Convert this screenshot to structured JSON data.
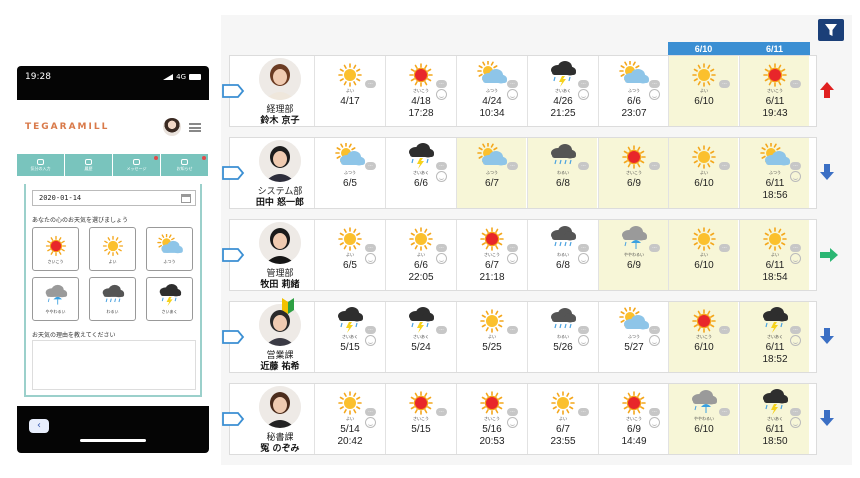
{
  "phone": {
    "time": "19:28",
    "network": "4G",
    "logo": "TEGARAMILL",
    "tabs": [
      {
        "label": "気分の入力"
      },
      {
        "label": "履歴"
      },
      {
        "label": "メッセージ"
      },
      {
        "label": "お知らせ"
      }
    ],
    "date_value": "2020-01-14",
    "prompt": "あなたの心のお天気を選びましょう",
    "options": [
      {
        "icon": "sunny-red",
        "label": "さいこう"
      },
      {
        "icon": "sunny",
        "label": "よい"
      },
      {
        "icon": "partly-cloudy",
        "label": "ふつう"
      },
      {
        "icon": "rain-cloud-umbrella",
        "label": "ややわるい"
      },
      {
        "icon": "rain-cloud",
        "label": "わるい"
      },
      {
        "icon": "thunder-cloud",
        "label": "さいあく"
      }
    ],
    "reason_prompt": "お天気の理由を教えてください",
    "back_label": "‹"
  },
  "dashboard": {
    "highlight_dates": [
      "6/10",
      "6/11"
    ],
    "colors": {
      "highlight": "#f7f6d7",
      "header": "#3b8fd3",
      "up": "#e02020",
      "down": "#3b6fc4",
      "flat": "#2bb673",
      "filter": "#1b3f78"
    },
    "rows": [
      {
        "dept": "経理部",
        "name": "鈴木 京子",
        "avatar": "woman-brown-hair",
        "trend": "up",
        "cells": [
          {
            "icon": "sunny",
            "label": "よい",
            "date": "4/17",
            "time": "",
            "smile": false,
            "hl": false
          },
          {
            "icon": "sunny-red",
            "label": "さいこう",
            "date": "4/18",
            "time": "17:28",
            "smile": true,
            "hl": false
          },
          {
            "icon": "partly-cloudy",
            "label": "ふつう",
            "date": "4/24",
            "time": "10:34",
            "smile": true,
            "hl": false
          },
          {
            "icon": "thunder-cloud",
            "label": "さいあく",
            "date": "4/26",
            "time": "21:25",
            "smile": true,
            "hl": false
          },
          {
            "icon": "partly-cloudy",
            "label": "ふつう",
            "date": "6/6",
            "time": "23:07",
            "smile": true,
            "hl": false
          },
          {
            "icon": "sunny",
            "label": "よい",
            "date": "6/10",
            "time": "",
            "smile": false,
            "hl": true
          },
          {
            "icon": "sunny-red",
            "label": "さいこう",
            "date": "6/11",
            "time": "19:43",
            "smile": false,
            "hl": true
          }
        ]
      },
      {
        "dept": "システム部",
        "name": "田中 怒一郎",
        "avatar": "man-short-hair",
        "trend": "down",
        "cells": [
          {
            "icon": "partly-cloudy",
            "label": "ふつう",
            "date": "6/5",
            "time": "",
            "smile": false,
            "hl": false
          },
          {
            "icon": "thunder-cloud",
            "label": "さいあく",
            "date": "6/6",
            "time": "",
            "smile": true,
            "hl": false
          },
          {
            "icon": "partly-cloudy",
            "label": "ふつう",
            "date": "6/7",
            "time": "",
            "smile": false,
            "hl": true
          },
          {
            "icon": "rain-cloud",
            "label": "わるい",
            "date": "6/8",
            "time": "",
            "smile": false,
            "hl": true
          },
          {
            "icon": "sunny-red",
            "label": "さいこう",
            "date": "6/9",
            "time": "",
            "smile": false,
            "hl": true
          },
          {
            "icon": "sunny",
            "label": "よい",
            "date": "6/10",
            "time": "",
            "smile": false,
            "hl": true
          },
          {
            "icon": "partly-cloudy",
            "label": "ふつう",
            "date": "6/11",
            "time": "18:56",
            "smile": true,
            "hl": true
          }
        ]
      },
      {
        "dept": "管理部",
        "name": "牧田 莉緒",
        "avatar": "woman-dark-hair",
        "trend": "flat",
        "cells": [
          {
            "icon": "sunny",
            "label": "よい",
            "date": "6/5",
            "time": "",
            "smile": true,
            "hl": false
          },
          {
            "icon": "sunny",
            "label": "よい",
            "date": "6/6",
            "time": "22:05",
            "smile": true,
            "hl": false
          },
          {
            "icon": "sunny-red",
            "label": "さいこう",
            "date": "6/7",
            "time": "21:18",
            "smile": true,
            "hl": false
          },
          {
            "icon": "rain-cloud",
            "label": "わるい",
            "date": "6/8",
            "time": "",
            "smile": true,
            "hl": false
          },
          {
            "icon": "rain-cloud-umbrella",
            "label": "ややわるい",
            "date": "6/9",
            "time": "",
            "smile": false,
            "hl": true
          },
          {
            "icon": "sunny",
            "label": "よい",
            "date": "6/10",
            "time": "",
            "smile": false,
            "hl": true
          },
          {
            "icon": "sunny",
            "label": "よい",
            "date": "6/11",
            "time": "18:54",
            "smile": true,
            "hl": true
          }
        ]
      },
      {
        "dept": "営業課",
        "name": "近藤 祐希",
        "avatar": "man-beginner-mark",
        "trend": "down",
        "cells": [
          {
            "icon": "thunder-cloud",
            "label": "さいあく",
            "date": "5/15",
            "time": "",
            "smile": true,
            "hl": false
          },
          {
            "icon": "thunder-cloud",
            "label": "さいあく",
            "date": "5/24",
            "time": "",
            "smile": false,
            "hl": false
          },
          {
            "icon": "sunny",
            "label": "よい",
            "date": "5/25",
            "time": "",
            "smile": false,
            "hl": false
          },
          {
            "icon": "rain-cloud",
            "label": "わるい",
            "date": "5/26",
            "time": "",
            "smile": true,
            "hl": false
          },
          {
            "icon": "partly-cloudy",
            "label": "ふつう",
            "date": "5/27",
            "time": "",
            "smile": true,
            "hl": false
          },
          {
            "icon": "sunny-red",
            "label": "さいこう",
            "date": "6/10",
            "time": "",
            "smile": false,
            "hl": true
          },
          {
            "icon": "thunder-cloud",
            "label": "さいあく",
            "date": "6/11",
            "time": "18:52",
            "smile": true,
            "hl": true
          }
        ]
      },
      {
        "dept": "秘書課",
        "name": "冤 のぞみ",
        "avatar": "woman-long-hair",
        "trend": "down",
        "cells": [
          {
            "icon": "sunny",
            "label": "よい",
            "date": "5/14",
            "time": "20:42",
            "smile": true,
            "hl": false
          },
          {
            "icon": "sunny-red",
            "label": "さいこう",
            "date": "5/15",
            "time": "",
            "smile": false,
            "hl": false
          },
          {
            "icon": "sunny-red",
            "label": "さいこう",
            "date": "5/16",
            "time": "20:53",
            "smile": true,
            "hl": false
          },
          {
            "icon": "sunny",
            "label": "よい",
            "date": "6/7",
            "time": "23:55",
            "smile": false,
            "hl": false
          },
          {
            "icon": "sunny-red",
            "label": "さいこう",
            "date": "6/9",
            "time": "14:49",
            "smile": true,
            "hl": false
          },
          {
            "icon": "rain-cloud-umbrella",
            "label": "ややわるい",
            "date": "6/10",
            "time": "",
            "smile": false,
            "hl": true
          },
          {
            "icon": "thunder-cloud",
            "label": "さいあく",
            "date": "6/11",
            "time": "18:50",
            "smile": true,
            "hl": true
          }
        ]
      }
    ]
  }
}
